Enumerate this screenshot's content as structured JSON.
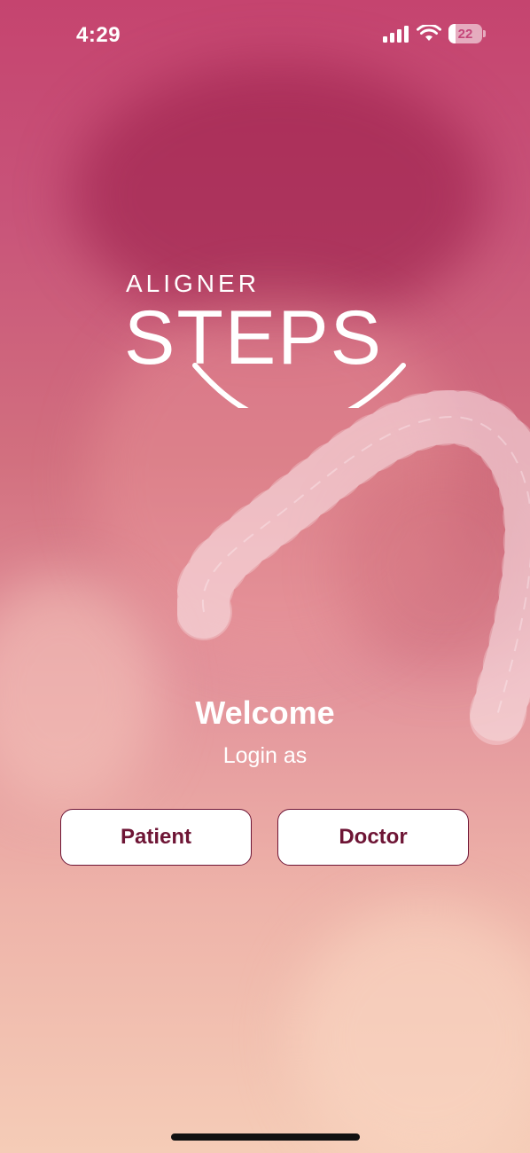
{
  "status_bar": {
    "time": "4:29",
    "battery_level": "22",
    "icons": [
      "signal-icon",
      "wifi-icon",
      "battery-icon"
    ]
  },
  "logo": {
    "top_text": "ALIGNER",
    "main_text": "STEPS"
  },
  "welcome": {
    "title": "Welcome",
    "subtitle": "Login as"
  },
  "buttons": {
    "patient_label": "Patient",
    "doctor_label": "Doctor"
  },
  "colors": {
    "brand_dark": "#6e1535",
    "background_top": "#c5446f",
    "background_bottom": "#f5ccb7",
    "button_background": "#ffffff"
  }
}
